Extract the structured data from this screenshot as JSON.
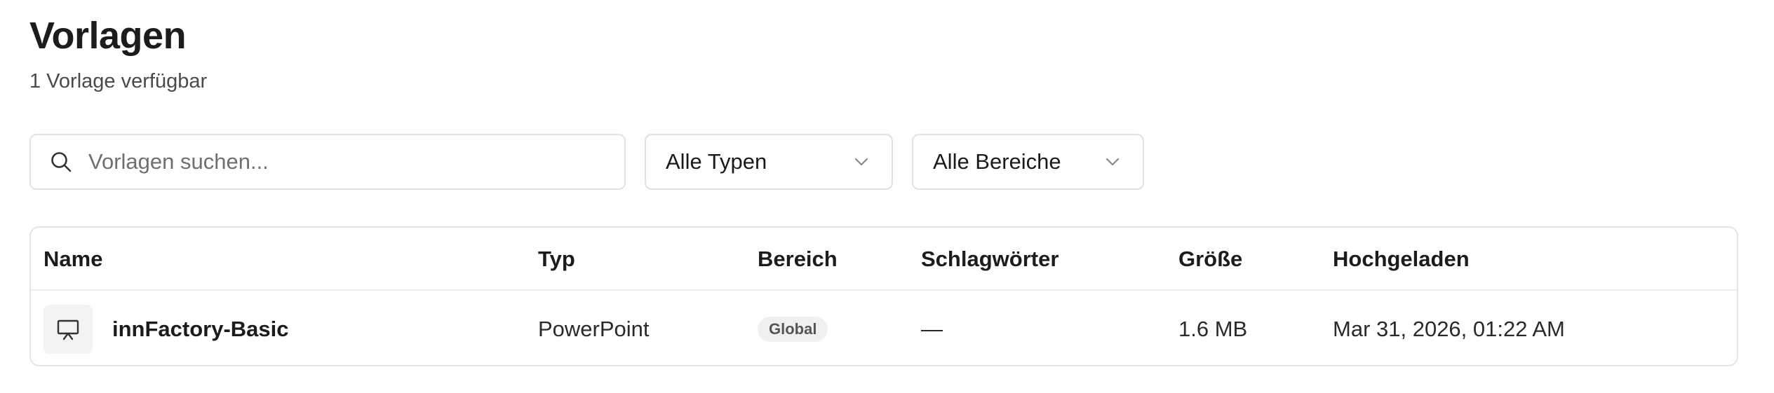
{
  "header": {
    "title": "Vorlagen",
    "subtitle": "1 Vorlage verfügbar"
  },
  "filters": {
    "search": {
      "placeholder": "Vorlagen suchen...",
      "value": "",
      "icon": "search-icon"
    },
    "type_select": {
      "selected": "Alle Typen",
      "icon": "chevron-down-icon"
    },
    "area_select": {
      "selected": "Alle Bereiche",
      "icon": "chevron-down-icon"
    }
  },
  "table": {
    "columns": {
      "name": "Name",
      "type": "Typ",
      "area": "Bereich",
      "tags": "Schlagwörter",
      "size": "Größe",
      "uploaded": "Hochgeladen"
    },
    "rows": [
      {
        "icon": "presentation-icon",
        "name": "innFactory-Basic",
        "type": "PowerPoint",
        "area": "Global",
        "tags": "—",
        "size": "1.6 MB",
        "uploaded": "Mar 31, 2026, 01:22 AM"
      }
    ]
  },
  "colors": {
    "border": "#e2e2e2",
    "badge_bg": "#f0f0f0",
    "icon_bg": "#f3f3f3",
    "text": "#1a1a1a",
    "muted": "#6f6f6f"
  }
}
